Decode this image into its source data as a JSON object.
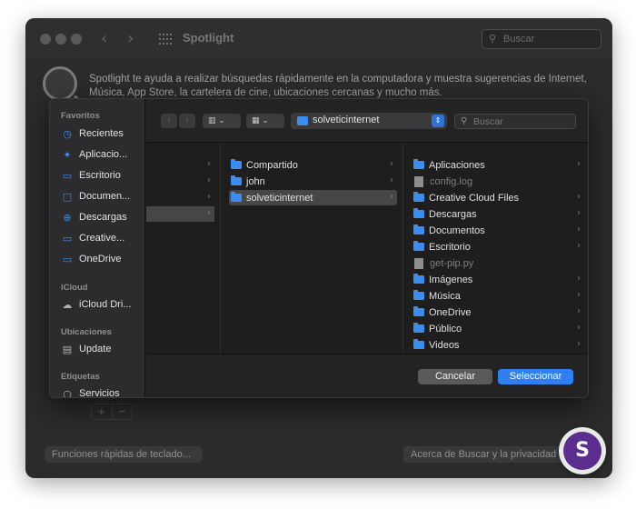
{
  "window": {
    "title": "Spotlight",
    "search_placeholder": "Buscar",
    "description": "Spotlight te ayuda a realizar búsquedas rápidamente en la computadora y muestra sugerencias de Internet, Música, App Store, la cartelera de cine, ubicaciones cercanas y mucho más.",
    "plus": "+",
    "minus": "−",
    "btn_keyboard": "Funciones rápidas de teclado...",
    "btn_about": "Acerca de Buscar y la privacidad"
  },
  "dialog": {
    "sidebar": {
      "favorites_label": "Favoritos",
      "favorites": [
        {
          "label": "Recientes",
          "icon": "clock-icon"
        },
        {
          "label": "Aplicacio...",
          "icon": "applications-icon"
        },
        {
          "label": "Escritorio",
          "icon": "desktop-icon"
        },
        {
          "label": "Documen...",
          "icon": "document-icon"
        },
        {
          "label": "Descargas",
          "icon": "download-icon"
        },
        {
          "label": "Creative...",
          "icon": "folder-icon"
        },
        {
          "label": "OneDrive",
          "icon": "folder-icon"
        }
      ],
      "icloud_label": "iCloud",
      "icloud": [
        {
          "label": "iCloud Dri...",
          "icon": "cloud-icon"
        }
      ],
      "locations_label": "Ubicaciones",
      "locations": [
        {
          "label": "Update",
          "icon": "drive-icon"
        }
      ],
      "tags_label": "Etiquetas",
      "tags": [
        {
          "label": "Servicios",
          "icon": "tag-circle-icon"
        }
      ]
    },
    "toolbar": {
      "back": "‹",
      "forward": "›",
      "view_columns": "▥ ⌄",
      "view_grid": "▦ ⌄",
      "path": "solveticinternet",
      "popup": "⇕",
      "search_placeholder": "Buscar"
    },
    "col2": [
      {
        "name": "Compartido"
      },
      {
        "name": "john"
      },
      {
        "name": "solveticinternet"
      }
    ],
    "col3": [
      {
        "name": "Aplicaciones",
        "type": "folder"
      },
      {
        "name": "config.log",
        "type": "file"
      },
      {
        "name": "Creative Cloud Files",
        "type": "folder"
      },
      {
        "name": "Descargas",
        "type": "folder"
      },
      {
        "name": "Documentos",
        "type": "folder"
      },
      {
        "name": "Escritorio",
        "type": "folder"
      },
      {
        "name": "get-pip.py",
        "type": "file"
      },
      {
        "name": "Imágenes",
        "type": "folder"
      },
      {
        "name": "Música",
        "type": "folder"
      },
      {
        "name": "OneDrive",
        "type": "folder"
      },
      {
        "name": "Público",
        "type": "folder"
      },
      {
        "name": "Videos",
        "type": "folder"
      }
    ],
    "chevron": "›",
    "cancel": "Cancelar",
    "select": "Seleccionar"
  },
  "watermark": {
    "letter": "S"
  },
  "colors": {
    "accent": "#2f7ff0",
    "folder": "#3b8df0"
  }
}
